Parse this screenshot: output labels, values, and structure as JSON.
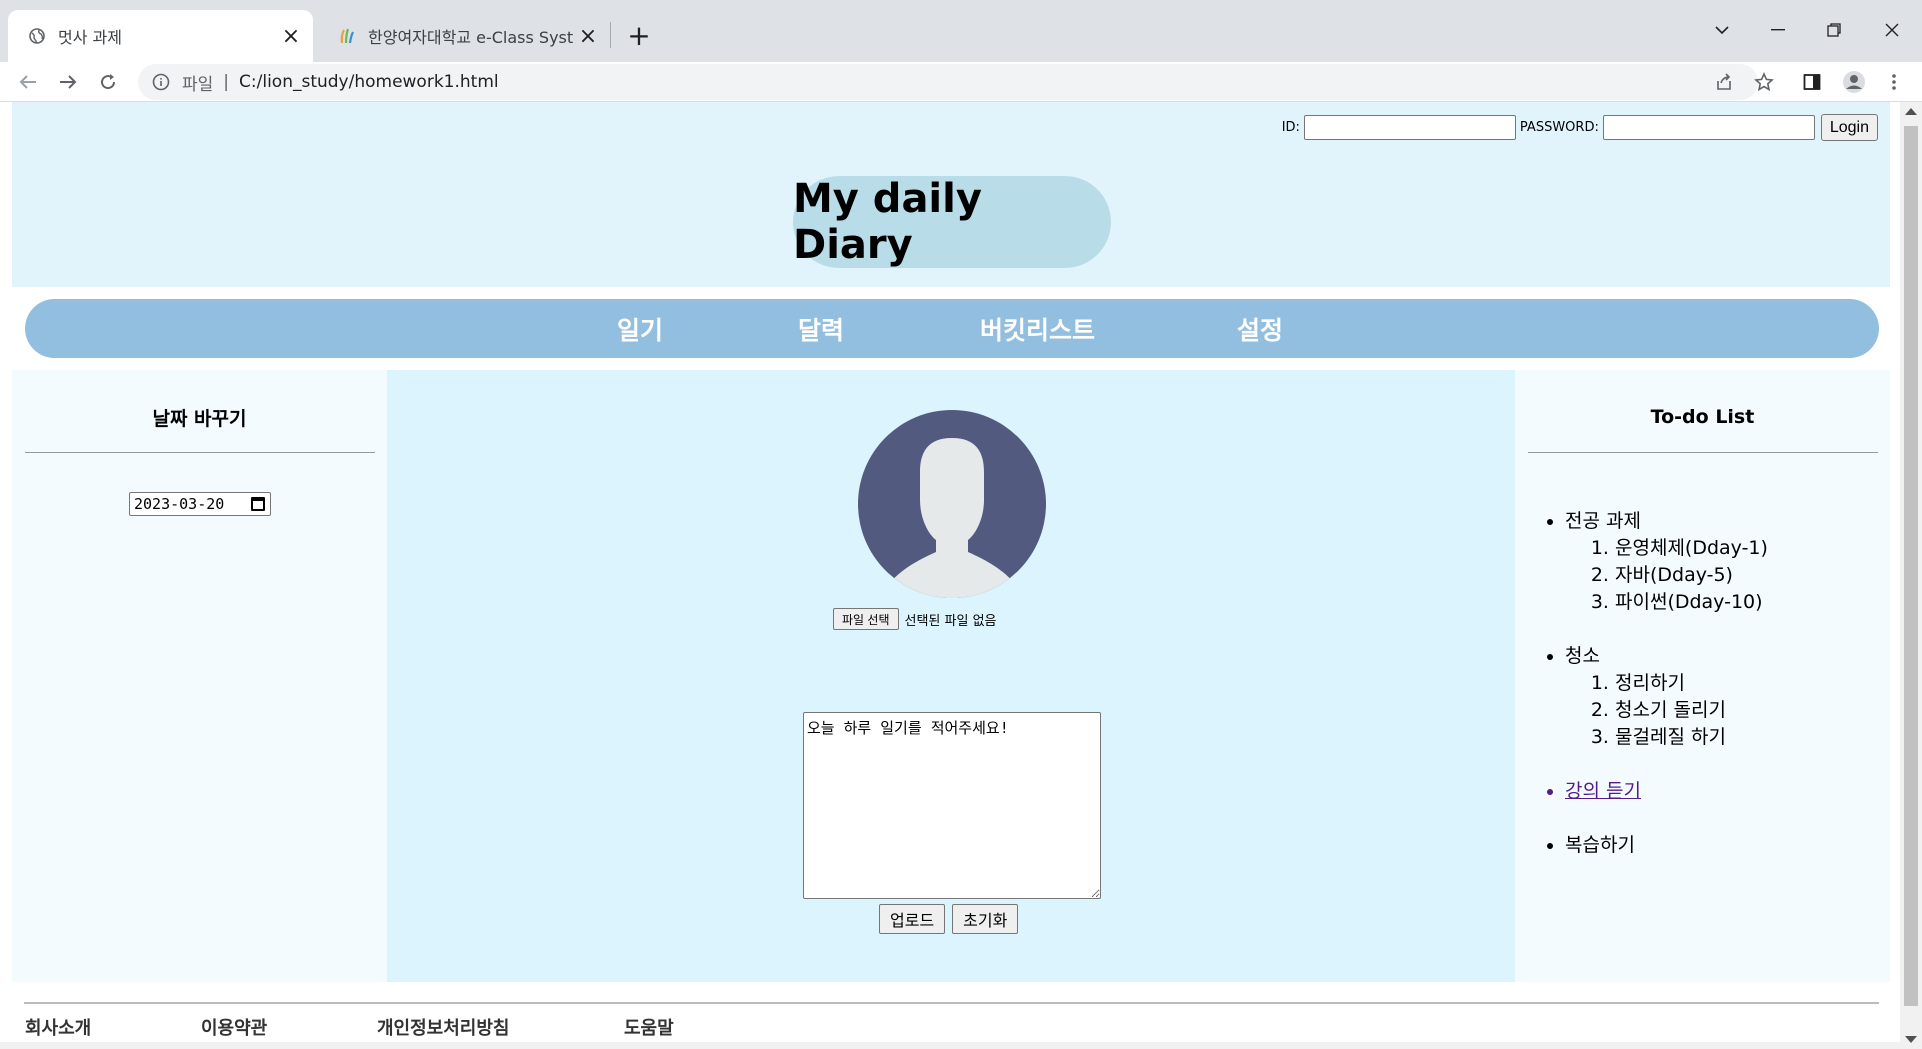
{
  "browser": {
    "tabs": [
      {
        "title": "멋사 과제",
        "active": true
      },
      {
        "title": "한양여자대학교 e-Class System",
        "active": false
      }
    ],
    "address": {
      "scheme_label": "파일",
      "url": "C:/lion_study/homework1.html"
    }
  },
  "login": {
    "id_label": "ID:",
    "password_label": "PASSWORD:",
    "button": "Login"
  },
  "header": {
    "title": "My daily Diary"
  },
  "nav": {
    "items": [
      "일기",
      "달력",
      "버킷리스트",
      "설정"
    ]
  },
  "left": {
    "title": "날짜 바꾸기",
    "date_value": "2023-03-20"
  },
  "center": {
    "file_button": "파일 선택",
    "file_status": "선택된 파일 없음",
    "diary_text": "오늘 하루 일기를 적어주세요!",
    "upload_button": "업로드",
    "reset_button": "초기화"
  },
  "right": {
    "title": "To-do List",
    "groups": [
      {
        "label": "전공 과제",
        "items": [
          "운영체제(Dday-1)",
          "자바(Dday-5)",
          "파이썬(Dday-10)"
        ]
      },
      {
        "label": "청소",
        "items": [
          "정리하기",
          "청소기 돌리기",
          "물걸레질 하기"
        ]
      }
    ],
    "link_item": "강의 듣기",
    "last_item": "복습하기"
  },
  "footer": {
    "links": [
      "회사소개",
      "이용약관",
      "개인정보처리방침",
      "도움말"
    ]
  },
  "colors": {
    "header_bg": "#e1f4fc",
    "logo_pill": "#b9dde8",
    "nav_bg": "#92bfdf",
    "center_bg": "#dcf4fd",
    "side_bg": "#f4fbff",
    "avatar_circle": "#525b7f"
  }
}
